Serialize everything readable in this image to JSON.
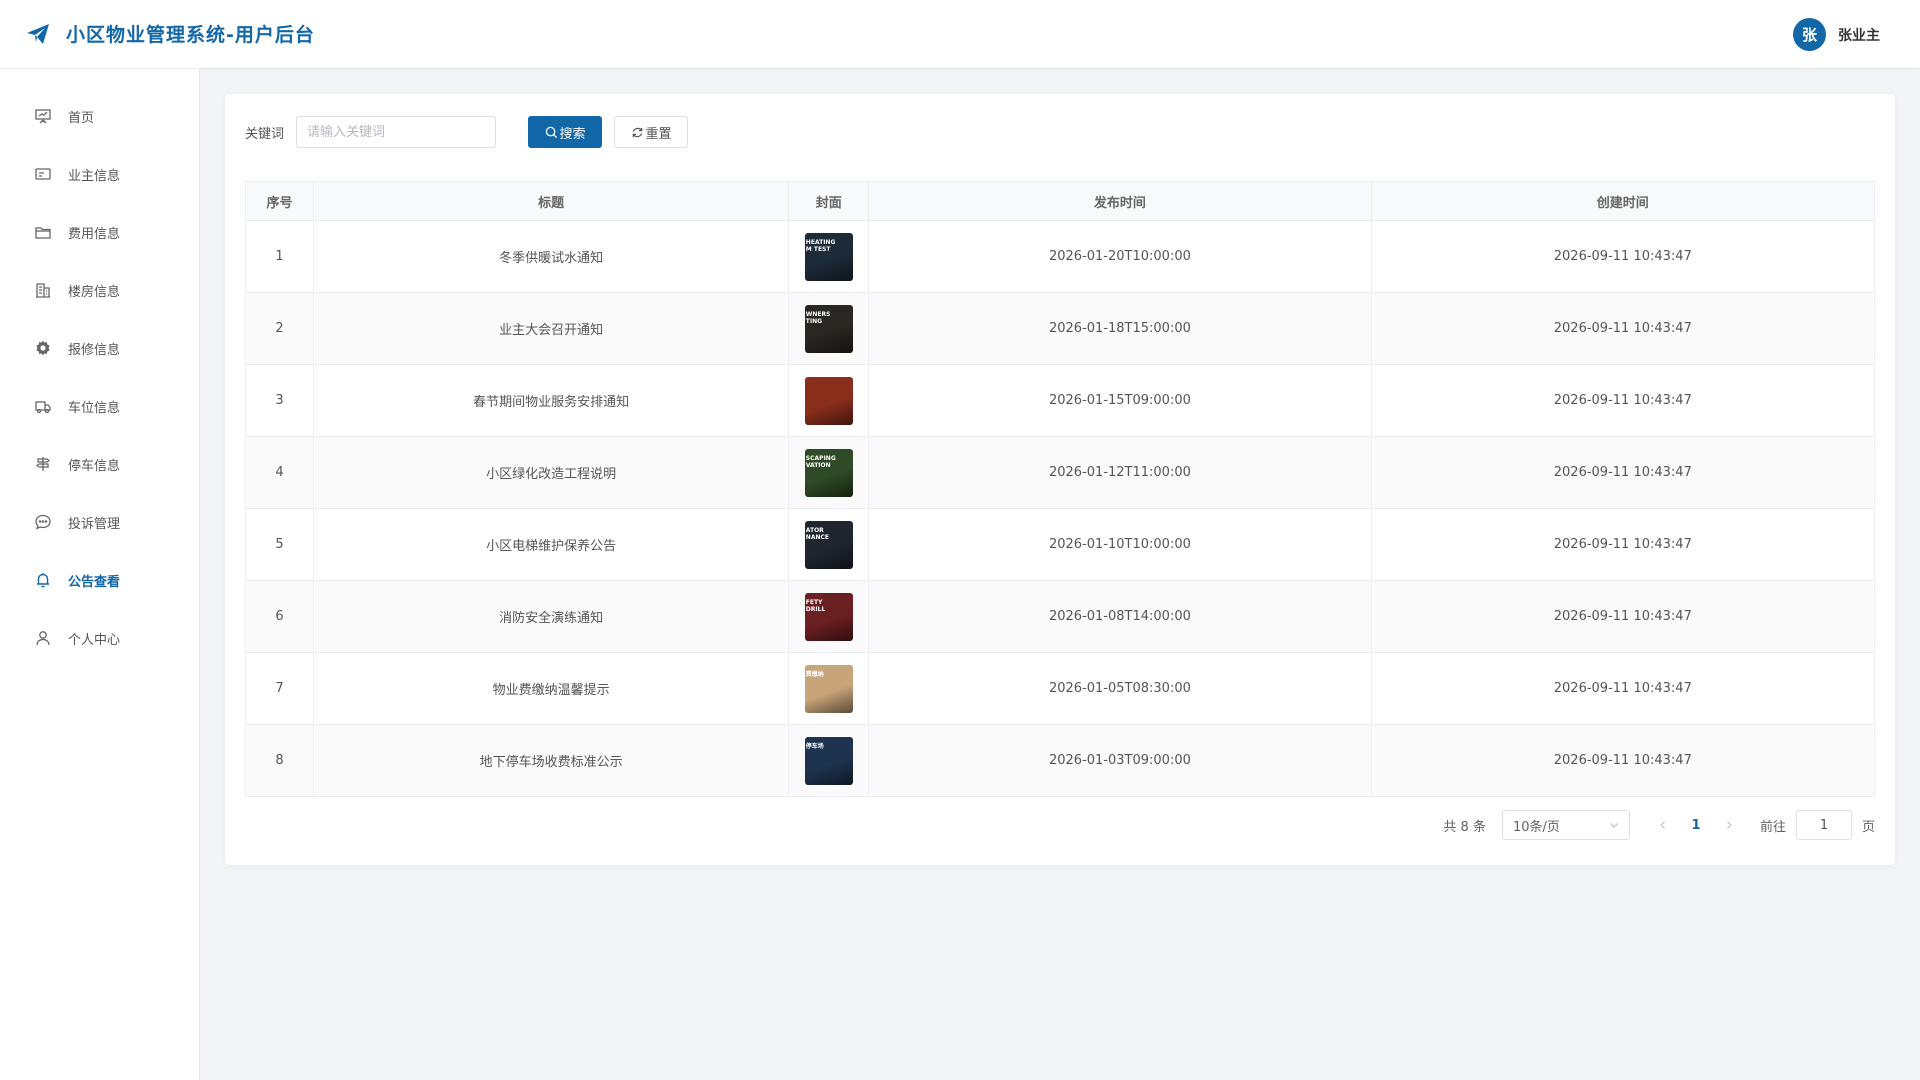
{
  "app": {
    "title": "小区物业管理系统-用户后台",
    "accent": "#1267a8"
  },
  "user": {
    "avatar_text": "张",
    "name": "张业主"
  },
  "sidebar": {
    "items": [
      {
        "label": "首页",
        "icon": "presentation-board-icon",
        "active": false
      },
      {
        "label": "业主信息",
        "icon": "id-card-icon",
        "active": false
      },
      {
        "label": "费用信息",
        "icon": "folder-icon",
        "active": false
      },
      {
        "label": "楼房信息",
        "icon": "building-icon",
        "active": false
      },
      {
        "label": "报修信息",
        "icon": "gear-icon",
        "active": false
      },
      {
        "label": "车位信息",
        "icon": "truck-icon",
        "active": false
      },
      {
        "label": "停车信息",
        "icon": "parking-icon",
        "active": false
      },
      {
        "label": "投诉管理",
        "icon": "chat-bubble-icon",
        "active": false
      },
      {
        "label": "公告查看",
        "icon": "bell-icon",
        "active": true
      },
      {
        "label": "个人中心",
        "icon": "user-icon",
        "active": false
      }
    ]
  },
  "search": {
    "label": "关键词",
    "placeholder": "请输入关键词",
    "value": "",
    "search_label": "搜索",
    "reset_label": "重置"
  },
  "table": {
    "columns": [
      "序号",
      "标题",
      "封面",
      "发布时间",
      "创建时间"
    ],
    "rows": [
      {
        "idx": "1",
        "title": "冬季供暖试水通知",
        "cover_text": "HEATING\nM TEST",
        "cover_color": "#1d2a38",
        "published": "2026-01-20T10:00:00",
        "created": "2026-09-11 10:43:47"
      },
      {
        "idx": "2",
        "title": "业主大会召开通知",
        "cover_text": "WNERS\nTING",
        "cover_color": "#2a2622",
        "published": "2026-01-18T15:00:00",
        "created": "2026-09-11 10:43:47"
      },
      {
        "idx": "3",
        "title": "春节期间物业服务安排通知",
        "cover_text": "",
        "cover_color": "#8a2e1c",
        "published": "2026-01-15T09:00:00",
        "created": "2026-09-11 10:43:47"
      },
      {
        "idx": "4",
        "title": "小区绿化改造工程说明",
        "cover_text": "SCAPING\nVATION",
        "cover_color": "#2f4a26",
        "published": "2026-01-12T11:00:00",
        "created": "2026-09-11 10:43:47"
      },
      {
        "idx": "5",
        "title": "小区电梯维护保养公告",
        "cover_text": "ATOR\nNANCE",
        "cover_color": "#1f2630",
        "published": "2026-01-10T10:00:00",
        "created": "2026-09-11 10:43:47"
      },
      {
        "idx": "6",
        "title": "消防安全演练通知",
        "cover_text": "FETY\nDRILL",
        "cover_color": "#6a1f22",
        "published": "2026-01-08T14:00:00",
        "created": "2026-09-11 10:43:47"
      },
      {
        "idx": "7",
        "title": "物业费缴纳温馨提示",
        "cover_text": "费缴纳",
        "cover_color": "#c8a47a",
        "published": "2026-01-05T08:30:00",
        "created": "2026-09-11 10:43:47"
      },
      {
        "idx": "8",
        "title": "地下停车场收费标准公示",
        "cover_text": "停车场",
        "cover_color": "#1e3350",
        "published": "2026-01-03T09:00:00",
        "created": "2026-09-11 10:43:47"
      }
    ]
  },
  "pagination": {
    "total_text": "共 8 条",
    "page_size": "10条/页",
    "current_page": "1",
    "goto_label": "前往",
    "goto_value": "1",
    "page_suffix": "页"
  }
}
